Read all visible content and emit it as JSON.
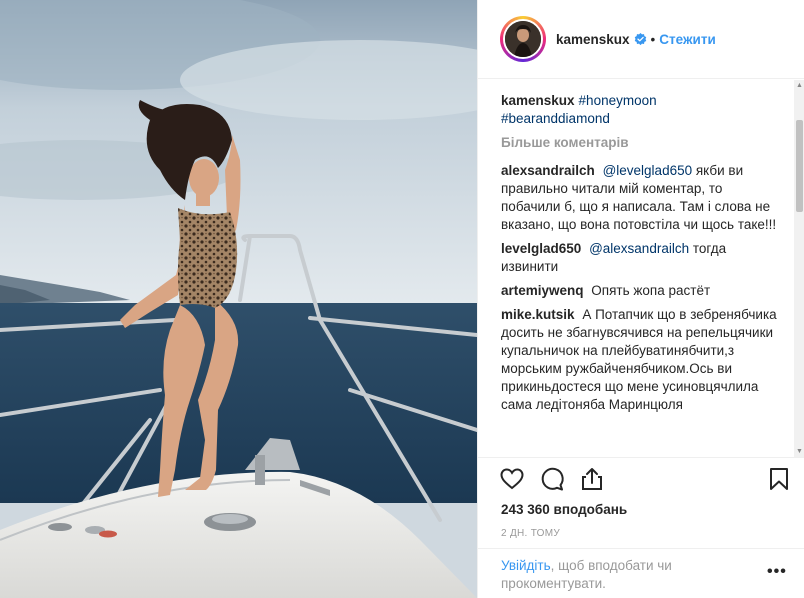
{
  "post": {
    "username": "kamenskux",
    "follow_label": "Стежити",
    "separator": "•",
    "caption_hashtags": [
      "#honeymoon",
      "#bearanddiamond"
    ],
    "more_comments_label": "Більше коментарів"
  },
  "comments": [
    {
      "user": "alexsandrailch",
      "mention": "@levelglad650",
      "text": "якби ви правильно читали мій коментар, то побачили б, що я написала. Там і слова не вказано, що вона потовстіла чи щось таке!!!"
    },
    {
      "user": "levelglad650",
      "mention": "@alexsandrailch",
      "text": "тогда извинити"
    },
    {
      "user": "artemiywenq",
      "mention": "",
      "text": "Опять жопа растёт"
    },
    {
      "user": "mike.kutsik",
      "mention": "",
      "text": "А Потапчик що в зебренябчика досить не збагнувсячився на репельцячики купальничок на плейбуватинябчити,з морським ружбайченябчиком.Ось ви прикиньдостеся що мене усиновцячлила сама ледітоняба Маринцюля"
    }
  ],
  "stats": {
    "likes": "243 360 вподобань",
    "time_ago": "2 ДН. ТОМУ"
  },
  "login": {
    "link": "Увійдіть",
    "text": ", щоб вподобати чи прокоментувати."
  },
  "icons": {
    "like": "heart-icon",
    "comment": "comment-icon",
    "share": "share-icon",
    "save": "bookmark-icon",
    "more": "more-options-icon",
    "verified": "verified-badge-icon"
  },
  "colors": {
    "link": "#3897f0",
    "mention": "#003569",
    "muted": "#999999",
    "text": "#262626"
  }
}
